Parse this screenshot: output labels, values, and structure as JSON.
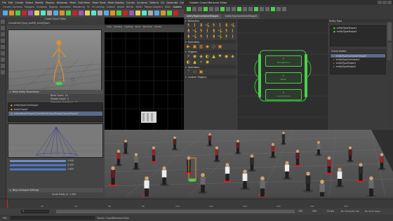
{
  "maya": {
    "menus": [
      "File",
      "Edit",
      "Create",
      "Select",
      "Modify",
      "Display",
      "Windows",
      "Mesh",
      "Edit Mesh",
      "Mesh Tools",
      "Mesh Display",
      "Curves",
      "Surfaces",
      "Deform",
      "UV",
      "Generate",
      "Cache",
      "Golaem",
      "Help"
    ],
    "shelf_tabs": [
      "Curves / Surfaces",
      "Polygons",
      "Sculpting",
      "Rigging",
      "Animation",
      "Rendering",
      "FX",
      "FX Caching",
      "Custom",
      "Arnold",
      "Bifrost",
      "MASH",
      "Motion Graphics",
      "XGen",
      "Golaem"
    ],
    "active_shelf_tab": "Golaem",
    "left_panel": {
      "title": "Crowd Visual Editor",
      "tab": "CrowdEntityType_seaMH_entityType1",
      "attrs": [
        {
          "label": "Bone Count",
          "value": "14"
        },
        {
          "label": "Shader Count",
          "value": "3"
        },
        {
          "label": "Geometry Variations",
          "value": "12"
        }
      ],
      "section_title": "Mesh Entity Parameters",
      "selection_items": [
        "entityTypeOneShape1",
        "bodyShape1",
        "radiusBodyShape1|CrowdEntityTypeShape|1|bodyShape1"
      ],
      "sliders": [
        {
          "label": "Weight",
          "value": "1.000"
        },
        {
          "label": "Radius",
          "value": "0.450"
        },
        {
          "label": "Height",
          "value": "1.800"
        }
      ],
      "bottom_section": "Maya Viewport Settings",
      "bottom_label": "Scale Entity Id",
      "bottom_value": "1.000"
    },
    "viewport": {
      "menus": [
        "View",
        "Shading",
        "Lighting",
        "Show",
        "Renderer",
        "Panels"
      ]
    },
    "timeline": {
      "ticks": [
        "1",
        "20",
        "40",
        "60",
        "80",
        "100",
        "120",
        "140",
        "160",
        "180",
        "200"
      ],
      "current_frame": "0"
    },
    "range": {
      "start": "1",
      "end": "250",
      "anim_start": "1",
      "anim_end": "250",
      "fps": "24 fps",
      "char_set": "No Character Set",
      "anim_layer": "No Anim Layer"
    },
    "cmd": {
      "label": "MEL",
      "result": "Result: CrowdBehaviorEditor"
    }
  },
  "editor": {
    "title": "Golaem Crowd Behavior Editor",
    "tabs": [
      "entityTypeContainerShape1",
      "entityTypeContainerShape2"
    ],
    "active_tab": "entityTypeContainerShape1",
    "library": {
      "sections": [
        {
          "title": "Behaviors",
          "icons": [
            "🏃",
            "🚶",
            "🧍",
            "🤸",
            "🏃",
            "🚶",
            "🧍",
            "🤸",
            "🧍",
            "🤸",
            "🏃",
            "🚶",
            "🧍",
            "🤸",
            "🏃",
            "🚶",
            "🧍",
            "🤸",
            "🏃",
            "🚶",
            "🧍",
            "🤸",
            "🏃",
            "🚶"
          ]
        },
        {
          "title": "Operators",
          "icons": [
            "▶",
            "▣",
            "▥",
            "◆",
            "◇",
            "▣"
          ]
        },
        {
          "title": "Triggers",
          "icons": [
            "⚡",
            "◉",
            "◈",
            "◐",
            "▲",
            "⚑",
            "◉",
            "◈",
            "◐",
            "▲",
            "⚡",
            "◉"
          ]
        },
        {
          "title": "Operators",
          "icons": [
            "⌃",
            "◇",
            "▣"
          ]
        },
        {
          "title": "Custom Triggers",
          "icons": []
        }
      ],
      "subtitle": "Behaviors",
      "sub2": "Trigger Icon"
    },
    "graph": {
      "nodes": [
        {
          "label": "entityTypeContainer1",
          "sub": "Navigation1"
        },
        {
          "label": "entityTypeContainer1",
          "sub": "Walk1"
        },
        {
          "label": "entityTypeContainer1",
          "sub": "Locomotion1"
        }
      ]
    },
    "right_panel": {
      "top_title": "Entity Type",
      "top_items": [
        "entityTypeShape1",
        "entityTypeShape2"
      ],
      "bottom_title": "Scene Nodes",
      "bottom_items": [
        "entityTypeContainerShape1",
        "entityTypeContainer1",
        "entityTypeShape1",
        "entityTypeShape2"
      ]
    }
  },
  "colors": {
    "accent_green": "#4bd14b",
    "accent_orange": "#e0902a",
    "accent_blue": "#4a78c8",
    "red_marker": "#c8232b"
  }
}
